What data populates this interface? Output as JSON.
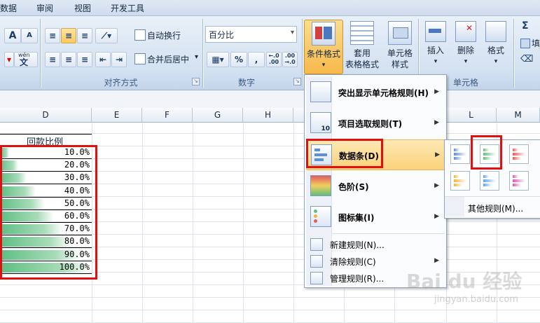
{
  "tabs": [
    "数据",
    "审阅",
    "视图",
    "开发工具"
  ],
  "ribbon": {
    "font_a_big": "A",
    "font_a_small": "A",
    "wen_label": "wén",
    "wen_char": "文",
    "wrap_text": "自动换行",
    "merge_center": "合并后居中",
    "number_format": "百分比",
    "percent": "%",
    "comma": ",",
    "dec_inc": "←.0\n.00",
    "dec_dec": ".00\n→.0",
    "alignment_group": "对齐方式",
    "number_group": "数字",
    "conditional_format": "条件格式",
    "table_format_1": "套用",
    "table_format_2": "表格格式",
    "cell_style_1": "单元格",
    "cell_style_2": "样式",
    "insert": "插入",
    "delete": "删除",
    "format": "格式",
    "cells_group": "单元格",
    "sigma": "Σ",
    "fill_char": "填",
    "clear_char": "",
    "dropdown_arrow": "▾"
  },
  "columns": [
    "D",
    "E",
    "F",
    "G",
    "H",
    "L",
    "M"
  ],
  "table": {
    "header": "回款比例",
    "values": [
      10,
      20,
      30,
      40,
      50,
      60,
      70,
      80,
      90,
      100
    ],
    "labels": [
      "10.0%",
      "20.0%",
      "30.0%",
      "40.0%",
      "50.0%",
      "60.0%",
      "70.0%",
      "80.0%",
      "90.0%",
      "100.0%"
    ]
  },
  "menu": {
    "highlight_rules": "突出显示单元格规则(H)",
    "top_bottom_rules": "项目选取规则(T)",
    "data_bars": "数据条(D)",
    "color_scales": "色阶(S)",
    "icon_sets": "图标集(I)",
    "new_rule": "新建规则(N)...",
    "clear_rules": "清除规则(C)",
    "manage_rules": "管理规则(R)...",
    "top10_label": "10",
    "submenu_arrow": "▶"
  },
  "submenu": {
    "more_rules": "其他规则(M)...",
    "bar_colors": [
      "#5b8fd6",
      "#63be7b",
      "#e25c5c",
      "#f0b43c",
      "#5aa5e6",
      "#d65ab2"
    ]
  },
  "watermark": {
    "brand": "Bai du 经验",
    "url": "jingyan.baidu.com"
  },
  "colors": {
    "highlight_red": "#e01010",
    "menu_hover": "#fbd27a"
  }
}
